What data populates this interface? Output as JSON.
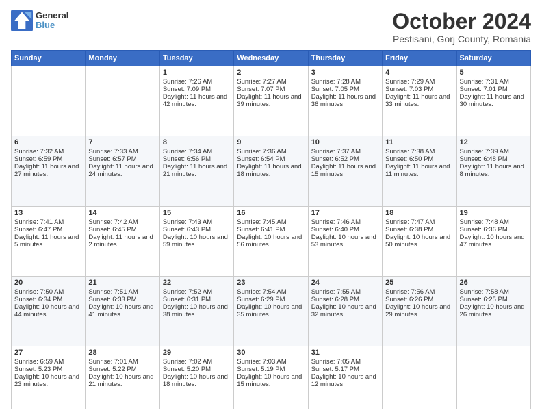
{
  "logo": {
    "line1": "General",
    "line2": "Blue"
  },
  "header": {
    "month": "October 2024",
    "location": "Pestisani, Gorj County, Romania"
  },
  "weekdays": [
    "Sunday",
    "Monday",
    "Tuesday",
    "Wednesday",
    "Thursday",
    "Friday",
    "Saturday"
  ],
  "weeks": [
    [
      {
        "day": "",
        "sunrise": "",
        "sunset": "",
        "daylight": ""
      },
      {
        "day": "",
        "sunrise": "",
        "sunset": "",
        "daylight": ""
      },
      {
        "day": "1",
        "sunrise": "Sunrise: 7:26 AM",
        "sunset": "Sunset: 7:09 PM",
        "daylight": "Daylight: 11 hours and 42 minutes."
      },
      {
        "day": "2",
        "sunrise": "Sunrise: 7:27 AM",
        "sunset": "Sunset: 7:07 PM",
        "daylight": "Daylight: 11 hours and 39 minutes."
      },
      {
        "day": "3",
        "sunrise": "Sunrise: 7:28 AM",
        "sunset": "Sunset: 7:05 PM",
        "daylight": "Daylight: 11 hours and 36 minutes."
      },
      {
        "day": "4",
        "sunrise": "Sunrise: 7:29 AM",
        "sunset": "Sunset: 7:03 PM",
        "daylight": "Daylight: 11 hours and 33 minutes."
      },
      {
        "day": "5",
        "sunrise": "Sunrise: 7:31 AM",
        "sunset": "Sunset: 7:01 PM",
        "daylight": "Daylight: 11 hours and 30 minutes."
      }
    ],
    [
      {
        "day": "6",
        "sunrise": "Sunrise: 7:32 AM",
        "sunset": "Sunset: 6:59 PM",
        "daylight": "Daylight: 11 hours and 27 minutes."
      },
      {
        "day": "7",
        "sunrise": "Sunrise: 7:33 AM",
        "sunset": "Sunset: 6:57 PM",
        "daylight": "Daylight: 11 hours and 24 minutes."
      },
      {
        "day": "8",
        "sunrise": "Sunrise: 7:34 AM",
        "sunset": "Sunset: 6:56 PM",
        "daylight": "Daylight: 11 hours and 21 minutes."
      },
      {
        "day": "9",
        "sunrise": "Sunrise: 7:36 AM",
        "sunset": "Sunset: 6:54 PM",
        "daylight": "Daylight: 11 hours and 18 minutes."
      },
      {
        "day": "10",
        "sunrise": "Sunrise: 7:37 AM",
        "sunset": "Sunset: 6:52 PM",
        "daylight": "Daylight: 11 hours and 15 minutes."
      },
      {
        "day": "11",
        "sunrise": "Sunrise: 7:38 AM",
        "sunset": "Sunset: 6:50 PM",
        "daylight": "Daylight: 11 hours and 11 minutes."
      },
      {
        "day": "12",
        "sunrise": "Sunrise: 7:39 AM",
        "sunset": "Sunset: 6:48 PM",
        "daylight": "Daylight: 11 hours and 8 minutes."
      }
    ],
    [
      {
        "day": "13",
        "sunrise": "Sunrise: 7:41 AM",
        "sunset": "Sunset: 6:47 PM",
        "daylight": "Daylight: 11 hours and 5 minutes."
      },
      {
        "day": "14",
        "sunrise": "Sunrise: 7:42 AM",
        "sunset": "Sunset: 6:45 PM",
        "daylight": "Daylight: 11 hours and 2 minutes."
      },
      {
        "day": "15",
        "sunrise": "Sunrise: 7:43 AM",
        "sunset": "Sunset: 6:43 PM",
        "daylight": "Daylight: 10 hours and 59 minutes."
      },
      {
        "day": "16",
        "sunrise": "Sunrise: 7:45 AM",
        "sunset": "Sunset: 6:41 PM",
        "daylight": "Daylight: 10 hours and 56 minutes."
      },
      {
        "day": "17",
        "sunrise": "Sunrise: 7:46 AM",
        "sunset": "Sunset: 6:40 PM",
        "daylight": "Daylight: 10 hours and 53 minutes."
      },
      {
        "day": "18",
        "sunrise": "Sunrise: 7:47 AM",
        "sunset": "Sunset: 6:38 PM",
        "daylight": "Daylight: 10 hours and 50 minutes."
      },
      {
        "day": "19",
        "sunrise": "Sunrise: 7:48 AM",
        "sunset": "Sunset: 6:36 PM",
        "daylight": "Daylight: 10 hours and 47 minutes."
      }
    ],
    [
      {
        "day": "20",
        "sunrise": "Sunrise: 7:50 AM",
        "sunset": "Sunset: 6:34 PM",
        "daylight": "Daylight: 10 hours and 44 minutes."
      },
      {
        "day": "21",
        "sunrise": "Sunrise: 7:51 AM",
        "sunset": "Sunset: 6:33 PM",
        "daylight": "Daylight: 10 hours and 41 minutes."
      },
      {
        "day": "22",
        "sunrise": "Sunrise: 7:52 AM",
        "sunset": "Sunset: 6:31 PM",
        "daylight": "Daylight: 10 hours and 38 minutes."
      },
      {
        "day": "23",
        "sunrise": "Sunrise: 7:54 AM",
        "sunset": "Sunset: 6:29 PM",
        "daylight": "Daylight: 10 hours and 35 minutes."
      },
      {
        "day": "24",
        "sunrise": "Sunrise: 7:55 AM",
        "sunset": "Sunset: 6:28 PM",
        "daylight": "Daylight: 10 hours and 32 minutes."
      },
      {
        "day": "25",
        "sunrise": "Sunrise: 7:56 AM",
        "sunset": "Sunset: 6:26 PM",
        "daylight": "Daylight: 10 hours and 29 minutes."
      },
      {
        "day": "26",
        "sunrise": "Sunrise: 7:58 AM",
        "sunset": "Sunset: 6:25 PM",
        "daylight": "Daylight: 10 hours and 26 minutes."
      }
    ],
    [
      {
        "day": "27",
        "sunrise": "Sunrise: 6:59 AM",
        "sunset": "Sunset: 5:23 PM",
        "daylight": "Daylight: 10 hours and 23 minutes."
      },
      {
        "day": "28",
        "sunrise": "Sunrise: 7:01 AM",
        "sunset": "Sunset: 5:22 PM",
        "daylight": "Daylight: 10 hours and 21 minutes."
      },
      {
        "day": "29",
        "sunrise": "Sunrise: 7:02 AM",
        "sunset": "Sunset: 5:20 PM",
        "daylight": "Daylight: 10 hours and 18 minutes."
      },
      {
        "day": "30",
        "sunrise": "Sunrise: 7:03 AM",
        "sunset": "Sunset: 5:19 PM",
        "daylight": "Daylight: 10 hours and 15 minutes."
      },
      {
        "day": "31",
        "sunrise": "Sunrise: 7:05 AM",
        "sunset": "Sunset: 5:17 PM",
        "daylight": "Daylight: 10 hours and 12 minutes."
      },
      {
        "day": "",
        "sunrise": "",
        "sunset": "",
        "daylight": ""
      },
      {
        "day": "",
        "sunrise": "",
        "sunset": "",
        "daylight": ""
      }
    ]
  ]
}
